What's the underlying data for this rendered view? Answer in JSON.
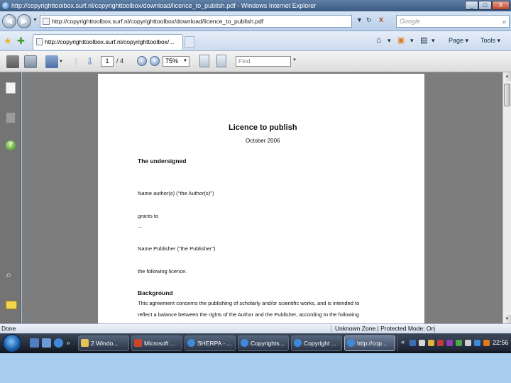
{
  "titlebar": {
    "title": "http://copyrighttoolbox.surf.nl/copyrighttoolbox/download/licence_to_publish.pdf - Windows Internet Explorer",
    "btn_min": "_",
    "btn_max": "□",
    "btn_close": "X"
  },
  "address": {
    "url": "http://copyrighttoolbox.surf.nl/copyrighttoolbox/download/licence_to_publish.pdf",
    "refresh_glyph": "↻",
    "stop_glyph": "X",
    "search_placeholder": "Google"
  },
  "tabs": {
    "active_tab": "http://copyrighttoolbox.surf.nl/copyrighttoolbox/...",
    "page_menu": "Page ▾",
    "tools_menu": "Tools ▾"
  },
  "pdf_toolbar": {
    "page_current": "1",
    "page_count": "/ 4",
    "zoom": "75%",
    "find_placeholder": "Find"
  },
  "document": {
    "title": "Licence to publish",
    "date": "October 2006",
    "undersigned": "The undersigned",
    "name_authors": "Name author(s) (\"the Author(s)\")",
    "grants_to": "grants to",
    "ellipsis": "...",
    "name_publisher": "Name Publisher (\"the Publisher\")",
    "following_licence": "the following licence.",
    "background_heading": "Background",
    "background_line1": "This agreement concerns the publishing of scholarly and/or scientific works, and is intended to",
    "background_line2": "reflect a balance between the rights of the Author and the Publisher, according to the following"
  },
  "statusbar": {
    "done": "Done",
    "zone": "Unknown Zone | Protected Mode: On"
  },
  "taskbar": {
    "tasks": [
      "2 Windo...",
      "Microsoft ...",
      "SHERPA - ...",
      "Copyrights...",
      "Copyright ...",
      "http://cop..."
    ],
    "clock": "22:56"
  },
  "colors": {
    "titlebar": "#3a5a82",
    "doc_background": "#7d7d7d",
    "page": "#ffffff",
    "desktop": "#a9cdef",
    "taskbar": "#11161e"
  },
  "icons": [
    "ie-icon",
    "back-icon",
    "forward-icon",
    "refresh-icon",
    "stop-icon",
    "search-icon",
    "favorites-star-icon",
    "add-favorites-icon",
    "page-icon",
    "home-icon",
    "feeds-icon",
    "print-icon",
    "save-icon",
    "hand-tool-icon",
    "prev-page-icon",
    "next-page-icon",
    "zoom-out-icon",
    "zoom-in-icon",
    "fit-page-icon",
    "fit-width-icon",
    "pages-panel-icon",
    "signatures-icon",
    "help-icon",
    "attachment-icon",
    "comments-icon",
    "start-orb-icon"
  ]
}
